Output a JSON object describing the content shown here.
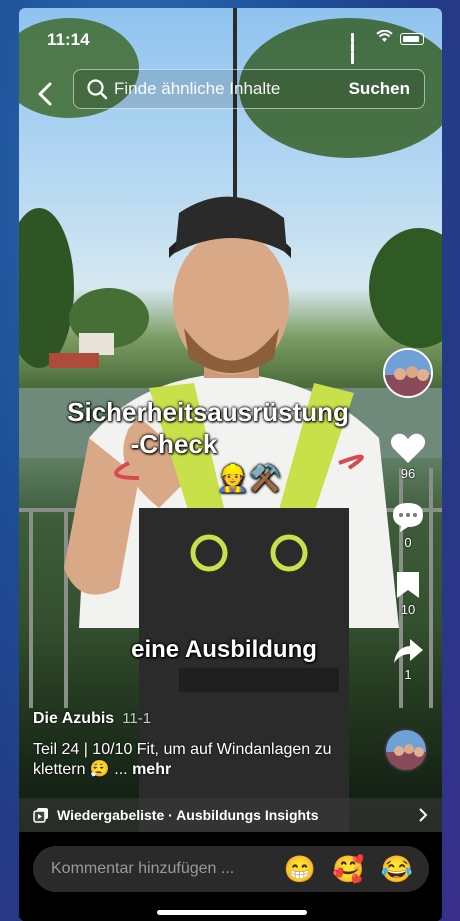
{
  "status_bar": {
    "time": "11:14"
  },
  "search": {
    "placeholder": "Finde ähnliche Inhalte",
    "submit_label": "Suchen"
  },
  "overlay": {
    "title_line1": "Sicherheitsausrüstung",
    "title_line2": "-Check",
    "title_emoji": "👷⚒️",
    "subtitle": "eine Ausbildung"
  },
  "actions": {
    "likes": "96",
    "comments": "0",
    "saves": "10",
    "shares": "1"
  },
  "post": {
    "author": "Die Azubis",
    "date": "11-1",
    "caption": "Teil 24 | 10/10 Fit, um auf Windanlagen zu klettern 😮‍💨 ...",
    "more_label": "mehr"
  },
  "playlist": {
    "label": "Wiedergabeliste · Ausbildungs Insights"
  },
  "comment": {
    "placeholder": "Kommentar hinzufügen ...",
    "emojis": [
      "😁",
      "🥰",
      "😂"
    ]
  },
  "colors": {
    "like": "#ffffff",
    "accent": "#ffffff",
    "input_bg": "#2a2a2a"
  }
}
